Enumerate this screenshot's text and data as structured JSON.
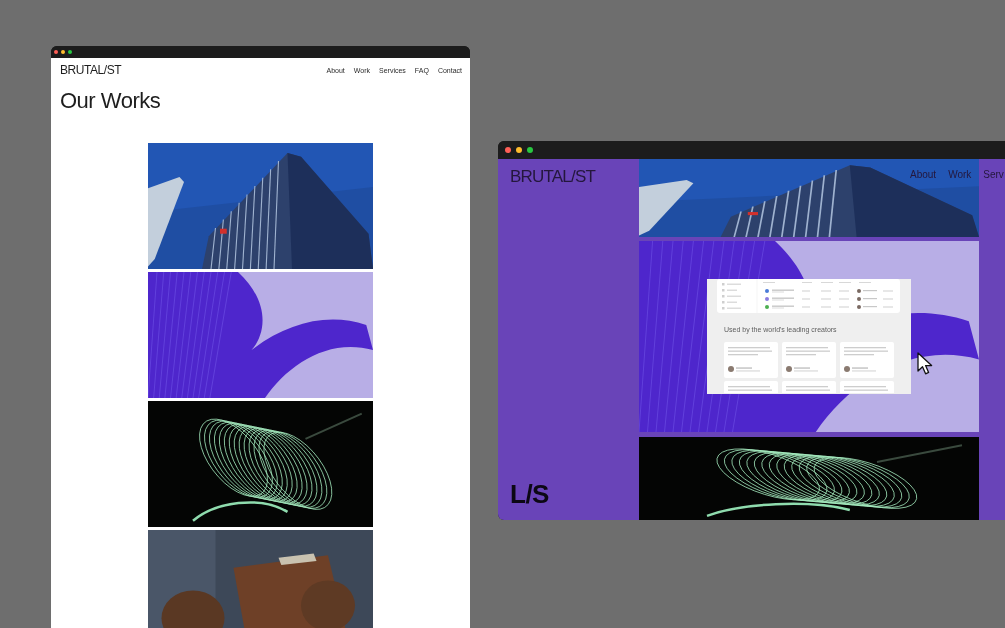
{
  "windows": [
    {
      "kind": "light",
      "brand": "BRUTAL/ST",
      "nav": [
        "About",
        "Work",
        "Services",
        "FAQ",
        "Contact"
      ],
      "heading": "Our Works",
      "photos": [
        {
          "kind": "building"
        },
        {
          "kind": "swirl"
        },
        {
          "kind": "spring"
        },
        {
          "kind": "wallet"
        }
      ]
    },
    {
      "kind": "purple",
      "brand": "BRUTAL/ST",
      "nav": [
        "About",
        "Work",
        "Serv"
      ],
      "photos": [
        {
          "kind": "building"
        },
        {
          "kind": "swirl",
          "inset": {
            "heading": "Used by the world's leading creators"
          }
        },
        {
          "kind": "spring"
        }
      ],
      "footer_mark": "L/S"
    }
  ]
}
